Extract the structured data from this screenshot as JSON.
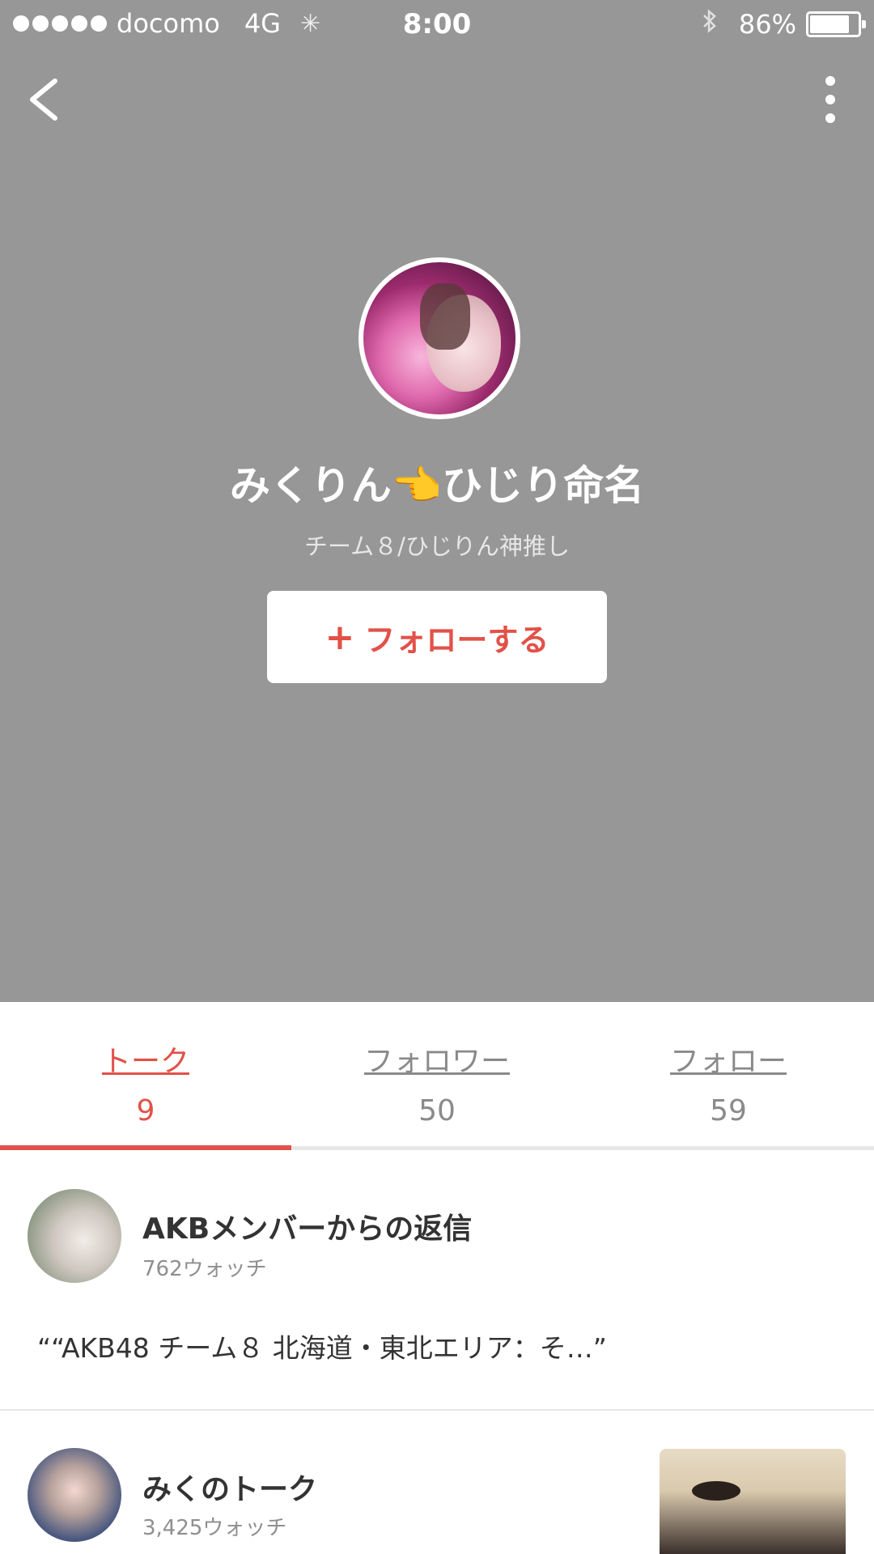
{
  "status_bar": {
    "carrier": "docomo",
    "network": "4G",
    "time": "8:00",
    "battery_pct": "86%",
    "battery_level": 0.86
  },
  "nav": {
    "back_icon": "chevron-left-icon",
    "more_icon": "more-vertical-icon"
  },
  "profile": {
    "name": "みくりん👈ひじり命名",
    "bio": "チーム８/ひじりん神推し",
    "follow_plus": "+",
    "follow_label": "フォローする"
  },
  "tabs": [
    {
      "label": "トーク",
      "count": "9",
      "active": true
    },
    {
      "label": "フォロワー",
      "count": "50",
      "active": false
    },
    {
      "label": "フォロー",
      "count": "59",
      "active": false
    }
  ],
  "talks": [
    {
      "title": "AKBメンバーからの返信",
      "watch": "762ウォッチ",
      "quote": "““AKB48 チーム８ 北海道・東北エリア：そ…”"
    },
    {
      "title": "みくのトーク",
      "watch": "3,425ウォッチ"
    }
  ],
  "colors": {
    "header_bg": "#979797",
    "accent": "#e25148"
  }
}
